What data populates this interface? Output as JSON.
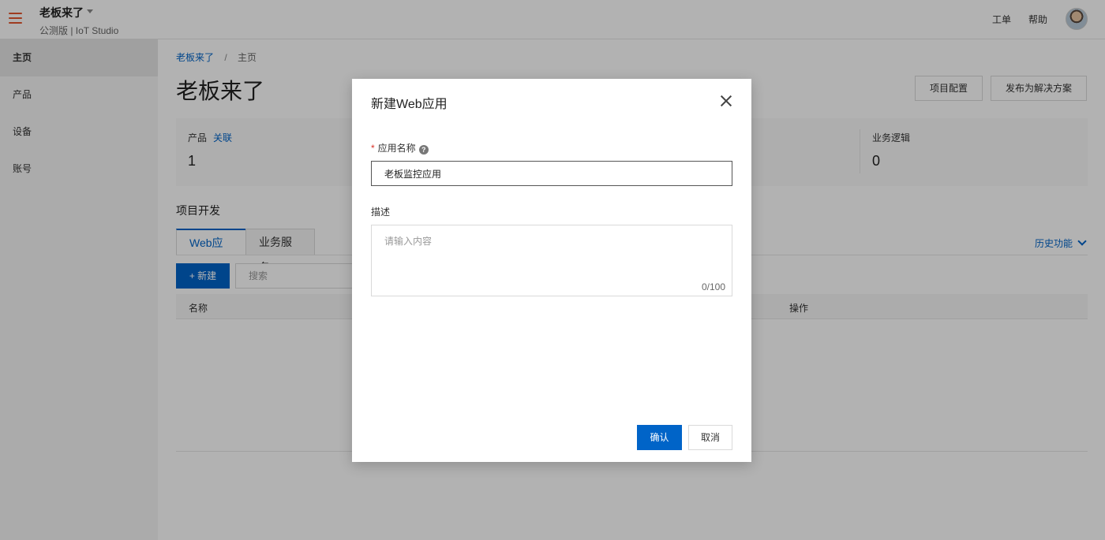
{
  "topbar": {
    "project_title": "老板来了",
    "subtitle": "公测版 | IoT Studio",
    "ticket_label": "工单",
    "help_label": "帮助"
  },
  "sidebar": {
    "items": [
      {
        "label": "主页"
      },
      {
        "label": "产品"
      },
      {
        "label": "设备"
      },
      {
        "label": "账号"
      }
    ]
  },
  "breadcrumb": {
    "project": "老板来了",
    "separator": "/",
    "current": "主页"
  },
  "page": {
    "title": "老板来了",
    "config_button": "项目配置",
    "publish_button": "发布为解决方案"
  },
  "stats": {
    "product_label": "产品",
    "product_link": "关联",
    "product_value": "1",
    "logic_label": "业务逻辑",
    "logic_value": "0"
  },
  "dev": {
    "section_title": "项目开发",
    "tabs": [
      {
        "label": "Web应用",
        "active": true
      },
      {
        "label": "业务服务",
        "active": false
      }
    ],
    "history_label": "历史功能",
    "new_button": "+ 新建",
    "search_placeholder": "搜索",
    "columns": [
      "名称",
      "操作"
    ]
  },
  "modal": {
    "title": "新建Web应用",
    "name_label": "应用名称",
    "required_mark": "*",
    "help_glyph": "?",
    "name_value": "老板监控应用",
    "desc_label": "描述",
    "desc_placeholder": "请输入内容",
    "desc_count": "0/100",
    "confirm_button": "确认",
    "cancel_button": "取消"
  },
  "colors": {
    "accent": "#0064c8",
    "menu_icon": "#e4572e",
    "required": "#d93026"
  }
}
